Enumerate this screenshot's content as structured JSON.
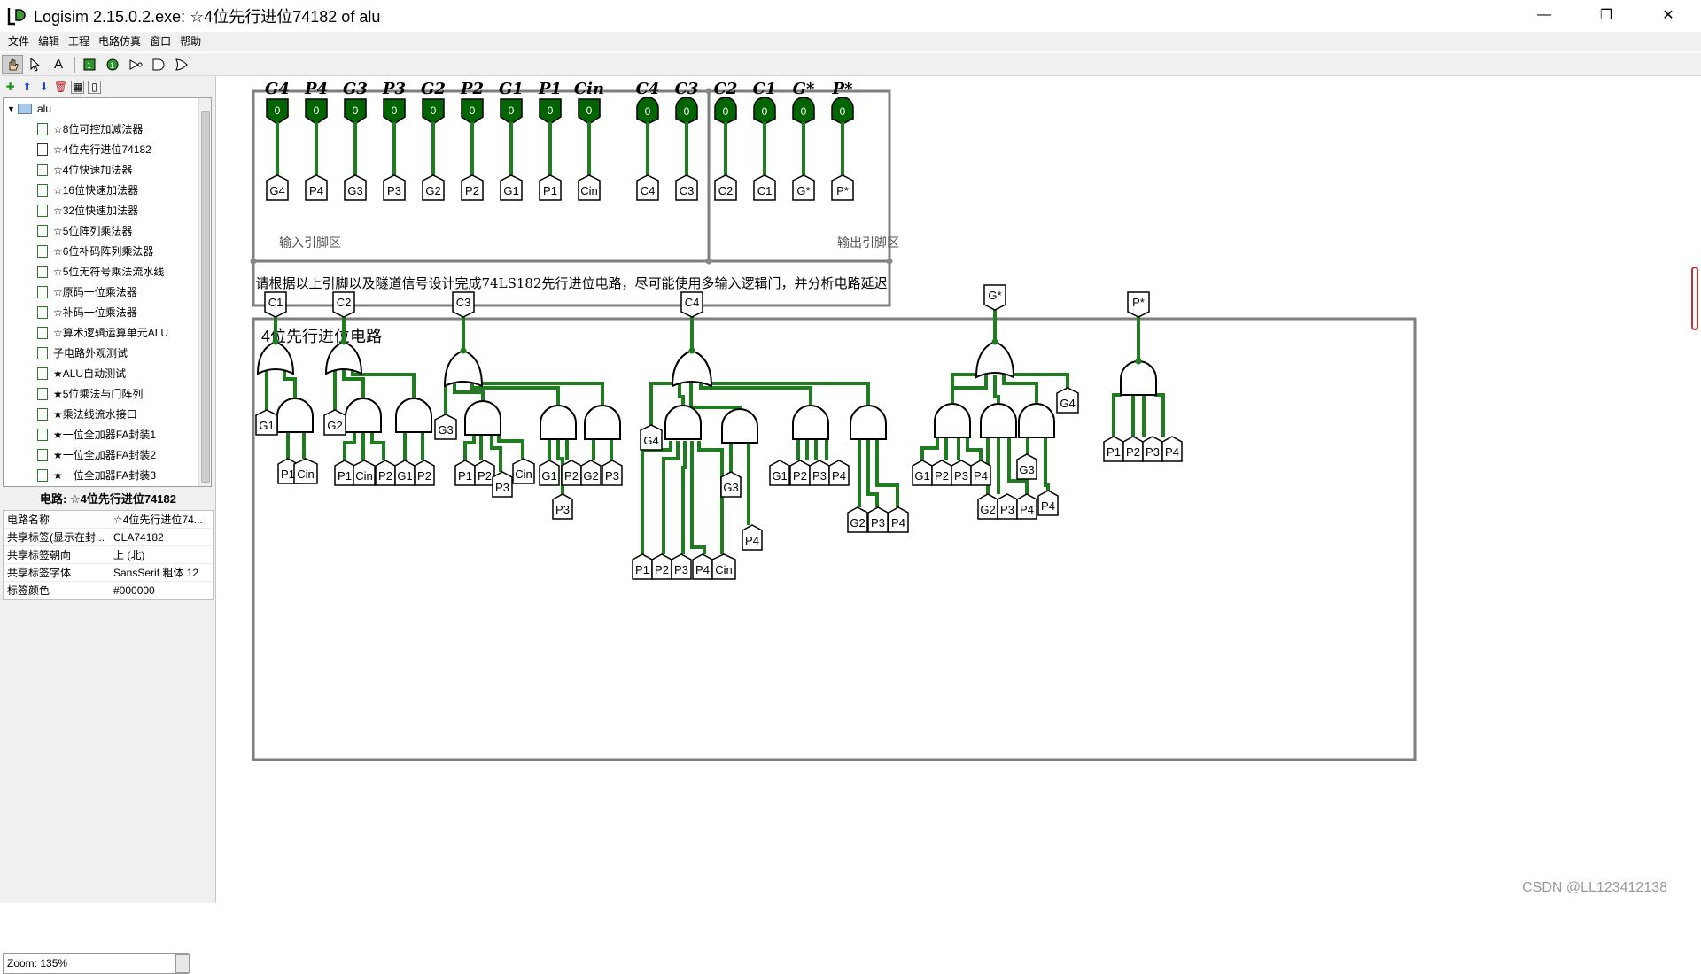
{
  "window": {
    "title": "Logisim 2.15.0.2.exe: ☆4位先行进位74182 of alu",
    "minimize": "—",
    "restore": "❐",
    "close": "✕"
  },
  "menu": [
    "文件",
    "编辑",
    "工程",
    "电路仿真",
    "窗口",
    "帮助"
  ],
  "toolbar": {
    "items": [
      "poke-tool",
      "select-tool",
      "text-tool",
      "input-pin",
      "output-pin",
      "not-gate",
      "and-gate",
      "or-gate"
    ],
    "text_tool_label": "A"
  },
  "tree": {
    "root": "alu",
    "items": [
      "☆8位可控加减法器",
      "☆4位先行进位74182",
      "☆4位快速加法器",
      "☆16位快速加法器",
      "☆32位快速加法器",
      "☆5位阵列乘法器",
      "☆6位补码阵列乘法器",
      "☆5位无符号乘法流水线",
      "☆原码一位乘法器",
      "☆补码一位乘法器",
      "☆算术逻辑运算单元ALU",
      "子电路外观测试",
      "★ALU自动测试",
      "★5位乘法与门阵列",
      "★乘法线流水接口",
      "★一位全加器FA封装1",
      "★一位全加器FA封装2",
      "★一位全加器FA封装3"
    ]
  },
  "properties": {
    "title": "电路: ☆4位先行进位74182",
    "rows": [
      {
        "k": "电路名称",
        "v": "☆4位先行进位74..."
      },
      {
        "k": "共享标签(显示在封...",
        "v": "CLA74182"
      },
      {
        "k": "共享标签朝向",
        "v": "上 (北)"
      },
      {
        "k": "共享标签字体",
        "v": "SansSerif 粗体 12"
      },
      {
        "k": "标签颜色",
        "v": "#000000"
      }
    ]
  },
  "zoom": "Zoom: 135%",
  "watermark": "CSDN @LL123412138",
  "canvas": {
    "input_pins": [
      "G4",
      "P4",
      "G3",
      "P3",
      "G2",
      "P2",
      "G1",
      "P1",
      "Cin"
    ],
    "output_pins": [
      "C4",
      "C3",
      "C2",
      "C1",
      "G*",
      "P*"
    ],
    "pin_value": "0",
    "input_area_label": "输入引脚区",
    "output_area_label": "输出引脚区",
    "instruction": "请根据以上引脚以及隧道信号设计完成74LS182先行进位电路，尽可能使用多输入逻辑门，并分析电路延迟",
    "circuit_title": "4位先行进位电路",
    "tunnels": {
      "c1_group": {
        "out": "C1",
        "g": "G1",
        "and_in": [
          "P1",
          "Cin"
        ]
      },
      "c2_group": {
        "out": "C2",
        "g": "G2",
        "and1": [
          "P1",
          "Cin",
          "P2"
        ],
        "and2": [
          "G1",
          "P2"
        ]
      },
      "c3_group": {
        "out": "C3",
        "g": "G3",
        "and1": [
          "P1",
          "P2",
          "P3",
          "Cin"
        ],
        "and2": [
          "G1",
          "P2",
          "P3"
        ],
        "and3": [
          "G2",
          "P3"
        ]
      },
      "c4_group": {
        "out": "C4",
        "g": "G4",
        "and1": [
          "P1",
          "P2",
          "P3",
          "P4",
          "Cin"
        ],
        "and2": [
          "G3",
          "P4"
        ],
        "and3": [
          "G1",
          "P2",
          "P3",
          "P4"
        ],
        "and4": [
          "G2",
          "P3",
          "P4"
        ]
      },
      "gstar_group": {
        "out": "G*",
        "g": "G4",
        "and1": [
          "G1",
          "P2",
          "P3",
          "P4"
        ],
        "and2": [
          "G2",
          "P3",
          "P4"
        ],
        "and3": [
          "G3",
          "P4"
        ]
      },
      "pstar_group": {
        "out": "P*",
        "and_in": [
          "P1",
          "P2",
          "P3",
          "P4"
        ]
      }
    }
  },
  "colors": {
    "wire": "#1e7d1e",
    "pin_fill": "#006400",
    "frame": "#7f7f7f"
  }
}
